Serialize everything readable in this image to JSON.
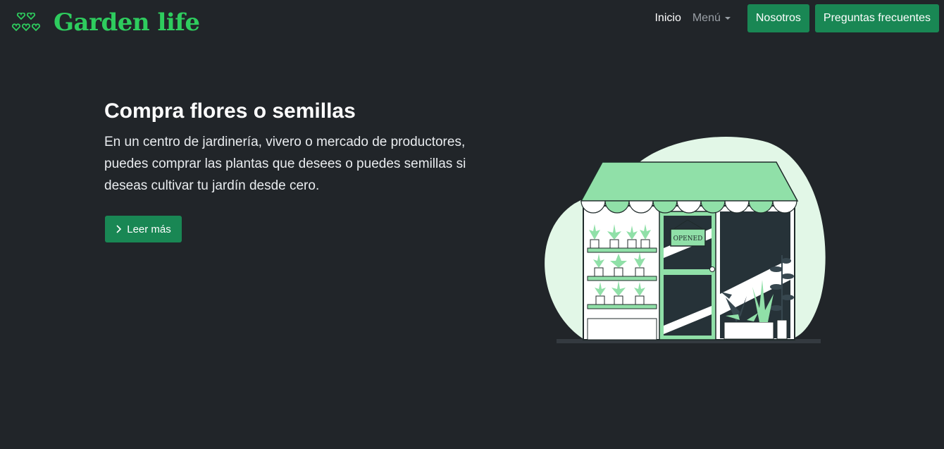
{
  "header": {
    "brand_name": "Garden life",
    "brand_icon": "hearts-icon",
    "nav": {
      "inicio": "Inicio",
      "menu": "Menú",
      "nosotros": "Nosotros",
      "faq": "Preguntas frecuentes"
    }
  },
  "hero": {
    "title": "Compra flores o semillas",
    "text": "En un centro de jardinería, vivero o mercado de productores, puedes comprar las plantas que desees o puedes semillas si deseas cultivar tu jardín desde cero.",
    "button_label": "Leer más",
    "button_icon": "chevron-right-icon",
    "illustration": {
      "name": "flower-shop-illustration",
      "sign_text": "OPENED"
    }
  },
  "colors": {
    "background": "#212529",
    "accent": "#198754",
    "brand": "#2ecc5e",
    "illustration_green": "#90e0a8",
    "illustration_mint": "#e2f7e7"
  }
}
